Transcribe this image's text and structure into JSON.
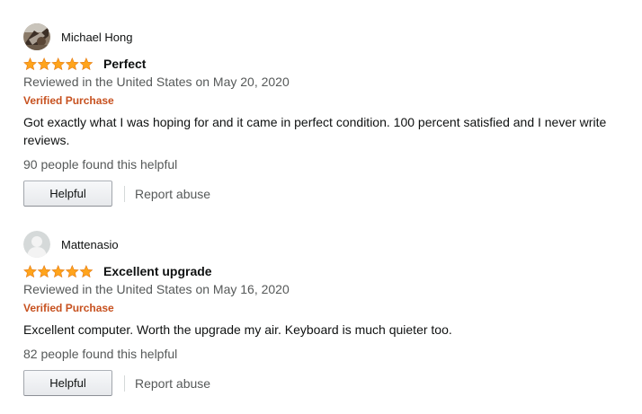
{
  "colors": {
    "star": "#FFA41C",
    "verified": "#C7511F",
    "muted_text": "#565959"
  },
  "reviews": [
    {
      "author": "Michael Hong",
      "avatar": "photo",
      "rating": 5,
      "rating_max": 5,
      "title": "Perfect",
      "reviewed_line": "Reviewed in the United States on May 20, 2020",
      "verified": "Verified Purchase",
      "body": "Got exactly what I was hoping for and it came in perfect condition. 100 percent satisfied and I never write reviews.",
      "helpful_count_text": "90 people found this helpful",
      "helpful_button": "Helpful",
      "report_link": "Report abuse"
    },
    {
      "author": "Mattenasio",
      "avatar": "default-user-icon",
      "rating": 5,
      "rating_max": 5,
      "title": "Excellent upgrade",
      "reviewed_line": "Reviewed in the United States on May 16, 2020",
      "verified": "Verified Purchase",
      "body": "Excellent computer. Worth the upgrade my air. Keyboard is much quieter too.",
      "helpful_count_text": "82 people found this helpful",
      "helpful_button": "Helpful",
      "report_link": "Report abuse"
    }
  ]
}
